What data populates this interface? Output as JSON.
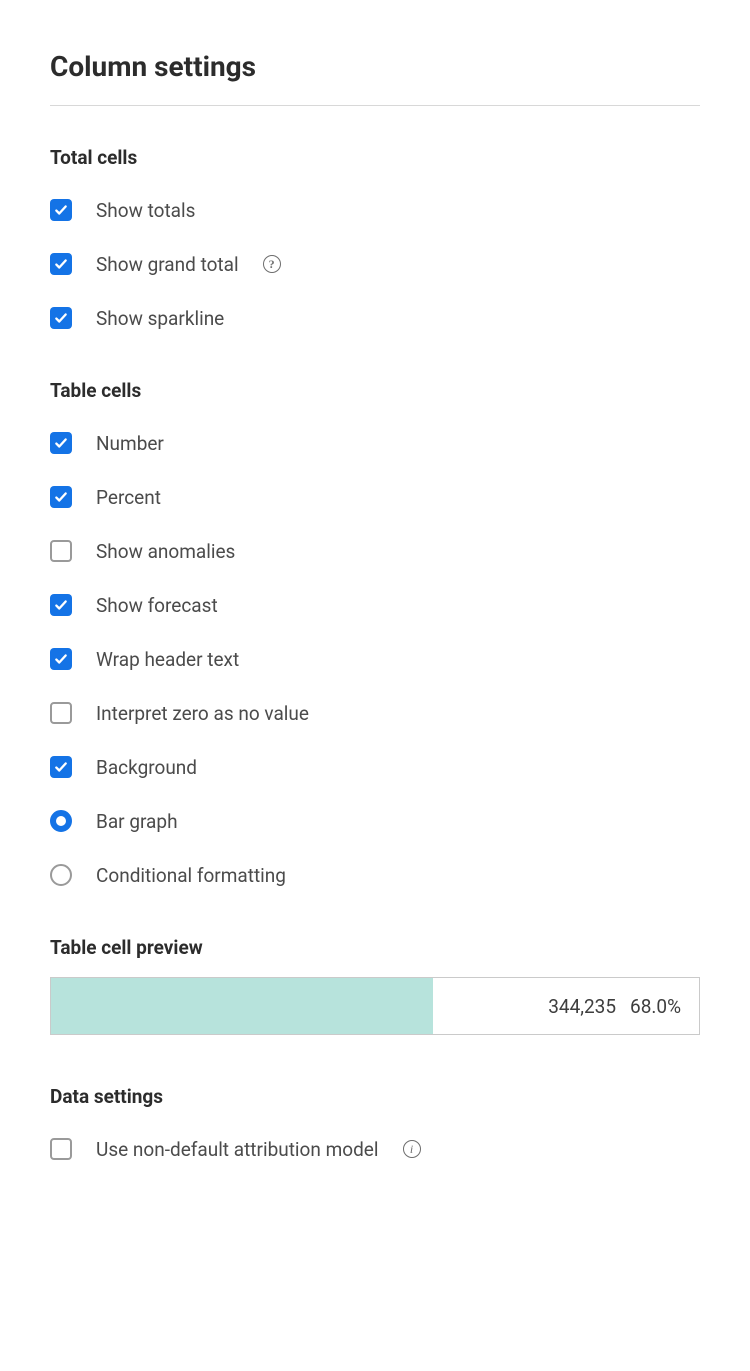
{
  "title": "Column settings",
  "sections": {
    "total_cells": {
      "header": "Total cells",
      "items": {
        "show_totals": {
          "label": "Show totals",
          "checked": true
        },
        "show_grand_total": {
          "label": "Show grand total",
          "checked": true,
          "help": true
        },
        "show_sparkline": {
          "label": "Show sparkline",
          "checked": true
        }
      }
    },
    "table_cells": {
      "header": "Table cells",
      "items": {
        "number": {
          "label": "Number",
          "checked": true
        },
        "percent": {
          "label": "Percent",
          "checked": true
        },
        "show_anomalies": {
          "label": "Show anomalies",
          "checked": false
        },
        "show_forecast": {
          "label": "Show forecast",
          "checked": true
        },
        "wrap_header": {
          "label": "Wrap header text",
          "checked": true
        },
        "interpret_zero": {
          "label": "Interpret zero as no value",
          "checked": false
        },
        "background": {
          "label": "Background",
          "checked": true
        },
        "bar_graph": {
          "label": "Bar graph",
          "type": "radio",
          "checked": true
        },
        "conditional_formatting": {
          "label": "Conditional formatting",
          "type": "radio",
          "checked": false
        }
      }
    },
    "preview": {
      "header": "Table cell preview",
      "number": "344,235",
      "percent": "68.0%",
      "bar_width": "59%"
    },
    "data_settings": {
      "header": "Data settings",
      "items": {
        "attribution": {
          "label": "Use non-default attribution model",
          "checked": false,
          "info": true
        }
      }
    }
  }
}
